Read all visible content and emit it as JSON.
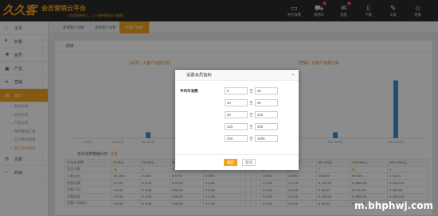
{
  "app": {
    "logo_text": "久久客",
    "title": "会员营销云平台",
    "subtitle": "· 会员营销中心，二十多种营销方式集锦"
  },
  "topnav": [
    {
      "label": "开店攻略",
      "icon": "monitor-icon",
      "glyph": "▭",
      "badge": ""
    },
    {
      "label": "购物车",
      "icon": "cart-icon",
      "glyph": "⛟",
      "badge": "0"
    },
    {
      "label": "消息",
      "icon": "message-icon",
      "glyph": "✉",
      "badge": "0"
    },
    {
      "label": "下载",
      "icon": "download-icon",
      "glyph": "⇩",
      "badge": ""
    },
    {
      "label": "工具",
      "icon": "tools-icon",
      "glyph": "✎",
      "badge": ""
    },
    {
      "label": "客服",
      "icon": "service-icon",
      "glyph": "☺",
      "badge": ""
    }
  ],
  "sidebar": {
    "items": [
      {
        "label": "主页",
        "icon": "home-icon",
        "glyph": "⌂",
        "chev": ""
      },
      {
        "label": "收银",
        "icon": "cashier-icon",
        "glyph": "¥",
        "chev": "‹"
      },
      {
        "label": "会员",
        "icon": "member-icon",
        "glyph": "☻",
        "chev": "‹"
      },
      {
        "label": "产品",
        "icon": "product-icon",
        "glyph": "▣",
        "chev": "‹"
      },
      {
        "label": "营销",
        "icon": "marketing-icon",
        "glyph": "✈",
        "chev": "‹"
      },
      {
        "label": "统计",
        "icon": "stats-icon",
        "glyph": "▤",
        "chev": "⌄"
      }
    ],
    "sub_items": [
      "会员分析",
      "财务分析",
      "产品分析",
      "库存数据汇总",
      "员工绩效报表",
      "客户分析报表"
    ],
    "bottom_items": [
      {
        "label": "设置",
        "icon": "settings-icon",
        "glyph": "⚙",
        "chev": "‹"
      },
      {
        "label": "商城",
        "icon": "shop-icon",
        "glyph": "⌂",
        "chev": ""
      }
    ]
  },
  "tabs": [
    "新增客户分析",
    "流失客户分析",
    "大客户分析"
  ],
  "panel": {
    "title": "图表"
  },
  "charts": {
    "left_title": "（会员）大客户消费分析",
    "right_title": "（营销）大客户消费分析",
    "left_categories": [
      "0-30元",
      "30-60元",
      "60-120元",
      "",
      ""
    ],
    "right_categories": [
      "",
      "120-300元",
      "300-1000元"
    ]
  },
  "chart_data": [
    {
      "type": "bar",
      "title": "（会员）大客户消费分析",
      "categories": [
        "0-30元",
        "30-60元",
        "60-120元"
      ],
      "values": [
        0,
        0,
        14
      ]
    },
    {
      "type": "bar",
      "title": "（营销）大客户消费分析",
      "categories": [
        "60-120元",
        "120-300元",
        "300-1000元"
      ],
      "values": [
        40,
        130,
        1270
      ]
    }
  ],
  "table": {
    "title": "会员消费数据分析",
    "set_label": "设置",
    "rows": [
      [
        "平均年消费",
        "0-30元",
        "30-60元",
        "60-120元",
        "120-300元",
        "",
        "",
        "",
        "",
        "0-30元",
        "30-60元",
        "60-120元",
        "120-300元",
        "300-1000元"
      ],
      [
        "会员人数",
        "14",
        "0",
        "1",
        "0",
        "",
        "",
        "",
        "",
        "0",
        "0",
        "7",
        "21",
        "6"
      ],
      [
        "人数占比",
        "93.33%",
        "0.00%",
        "6.67%",
        "0.00%",
        "",
        "",
        "",
        "",
        "0.00%",
        "0.00%",
        "20.00%",
        "60.00%",
        "17.14%"
      ],
      [
        "消费总额",
        "¥ 0.00",
        "¥ 0.00",
        "¥ 66.00",
        "¥ 0.00",
        "",
        "",
        "",
        "",
        "¥ 0.00",
        "¥ 0.00",
        "¥ 420.00",
        "¥ 3580.00",
        "¥ 1812.00"
      ],
      [
        "消费人均",
        "¥ 0.00",
        "¥ 0.00",
        "¥ 66.00",
        "¥ 0.00",
        "",
        "",
        "",
        "",
        "¥ 0.00",
        "¥ 0.00",
        "¥ 60.00",
        "¥ 170.48",
        "¥ 302.00"
      ],
      [
        "消费总数",
        "¥ 0.00",
        "¥ 0.00",
        "¥ 66.00",
        "¥ 0.00",
        "",
        "",
        "",
        "",
        "¥ 0.00",
        "¥ 0.00",
        "¥ 420.00",
        "¥ 3580.00",
        "¥ 1812.00"
      ],
      [
        "消费人均单价",
        "¥ 0.00",
        "¥ 0.00",
        "¥ 66.00",
        "¥ 0.00",
        "",
        "",
        "",
        "",
        "¥ 0.00",
        "¥ 0.00",
        "¥ 60.00",
        "¥ 170.48",
        "¥ 302.00"
      ]
    ]
  },
  "modal": {
    "title": "设置会员指标",
    "close": "×",
    "field_label": "平均年消费",
    "ranges": [
      {
        "from": "0",
        "sep": "至",
        "to": "30"
      },
      {
        "from": "30",
        "sep": "至",
        "to": "60"
      },
      {
        "from": "60",
        "sep": "至",
        "to": "120"
      },
      {
        "from": "120",
        "sep": "至",
        "to": "300"
      },
      {
        "from": "300",
        "sep": "至",
        "to": "1000"
      }
    ],
    "ok_label": "确定",
    "cancel_label": "取消"
  },
  "watermark": "m.bhphwj.com",
  "colors": {
    "accent": "#f3a21d",
    "bar": "#3b8fd0",
    "topbar": "#2b2b2b"
  }
}
